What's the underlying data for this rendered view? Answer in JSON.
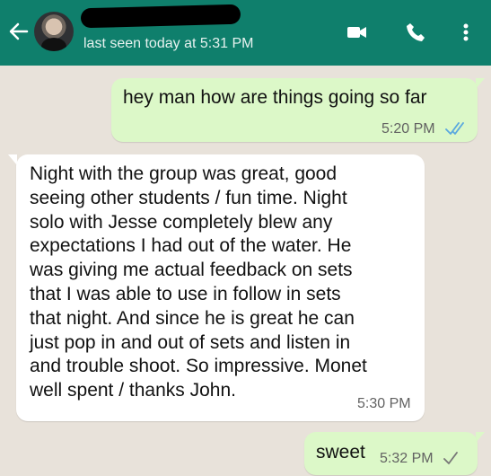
{
  "header": {
    "contact_name": "",
    "status": "last seen today at 5:31 PM",
    "icons": [
      "back-arrow-icon",
      "video-call-icon",
      "phone-icon",
      "menu-icon"
    ]
  },
  "messages": [
    {
      "direction": "outgoing",
      "text": "hey man how are things going so far",
      "time": "5:20 PM",
      "ticks": "double-check-icon"
    },
    {
      "direction": "incoming",
      "text": "Night with the group was great, good\nseeing other students / fun time.  Night\nsolo with Jesse completely blew any\nexpectations I had out of the water. He\nwas giving me actual feedback on sets\nthat I was able to use in follow in sets\nthat night. And since he is great he can\njust pop in and out of sets and listen in\nand trouble shoot.  So impressive. Monet\nwell spent / thanks John.",
      "time": "5:30 PM"
    },
    {
      "direction": "outgoing",
      "text": "sweet",
      "time": "5:32 PM",
      "ticks": "single-check-icon"
    }
  ],
  "colors": {
    "header_bg": "#0f7f6c",
    "chat_bg": "#e8e2da",
    "outgoing_bubble": "#dcf8c8",
    "incoming_bubble": "#ffffff",
    "read_tick": "#5aa8df"
  }
}
